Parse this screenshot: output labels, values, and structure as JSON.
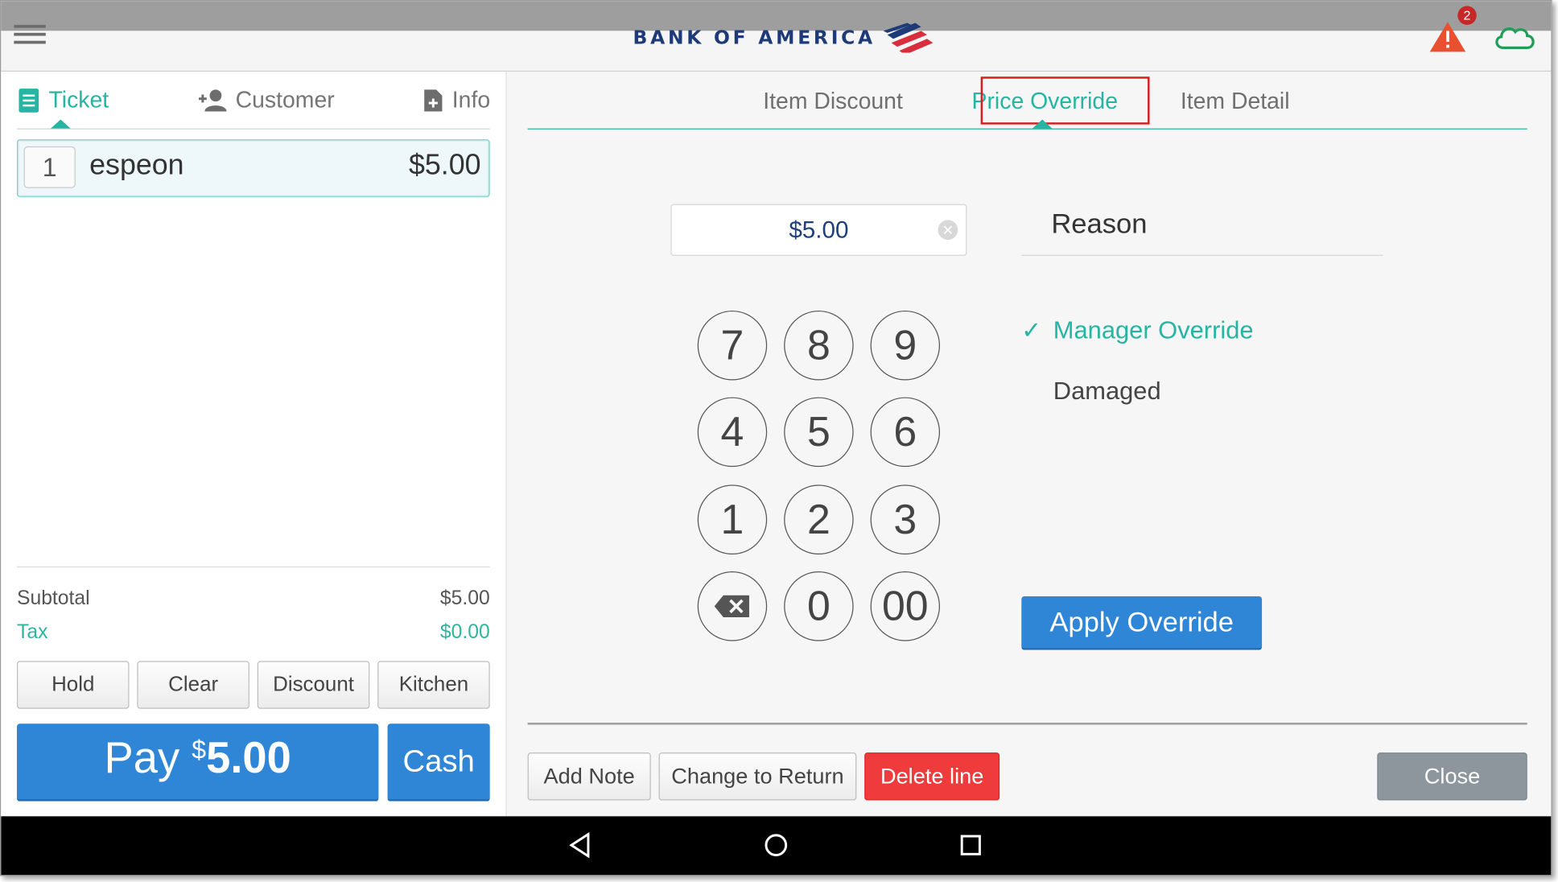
{
  "brand": {
    "name": "BANK OF AMERICA"
  },
  "topbar": {
    "alert_count": "2"
  },
  "left": {
    "tabs": [
      {
        "label": "Ticket"
      },
      {
        "label": "Customer"
      },
      {
        "label": "Info"
      }
    ],
    "item": {
      "qty": "1",
      "name": "espeon",
      "price": "$5.00"
    },
    "totals": {
      "subtotal_label": "Subtotal",
      "subtotal_value": "$5.00",
      "tax_label": "Tax",
      "tax_value": "$0.00"
    },
    "actions": {
      "hold": "Hold",
      "clear": "Clear",
      "discount": "Discount",
      "kitchen": "Kitchen"
    },
    "pay": {
      "label": "Pay",
      "currency": "$",
      "amount": "5.00"
    },
    "cash": "Cash"
  },
  "right": {
    "tabs": [
      {
        "label": "Item Discount"
      },
      {
        "label": "Price Override"
      },
      {
        "label": "Item Detail"
      }
    ],
    "amount": "$5.00",
    "keypad": [
      "7",
      "8",
      "9",
      "4",
      "5",
      "6",
      "1",
      "2",
      "3",
      "0",
      "00"
    ],
    "reason_title": "Reason",
    "reasons": [
      {
        "label": "Manager Override",
        "selected": true
      },
      {
        "label": "Damaged",
        "selected": false
      }
    ],
    "apply": "Apply Override",
    "footer": {
      "add_note": "Add Note",
      "change_return": "Change to Return",
      "delete_line": "Delete line",
      "close": "Close"
    }
  },
  "colors": {
    "accent": "#26b5a2",
    "primary": "#2f86d6",
    "danger": "#ef3b3b",
    "highlight": "#d61f1f"
  },
  "icons": [
    "menu-icon",
    "alert-icon",
    "cloud-icon",
    "ticket-icon",
    "add-customer-icon",
    "info-doc-icon",
    "clear-input-icon",
    "backspace-icon",
    "check-icon",
    "back-nav-icon",
    "home-nav-icon",
    "recents-nav-icon"
  ]
}
